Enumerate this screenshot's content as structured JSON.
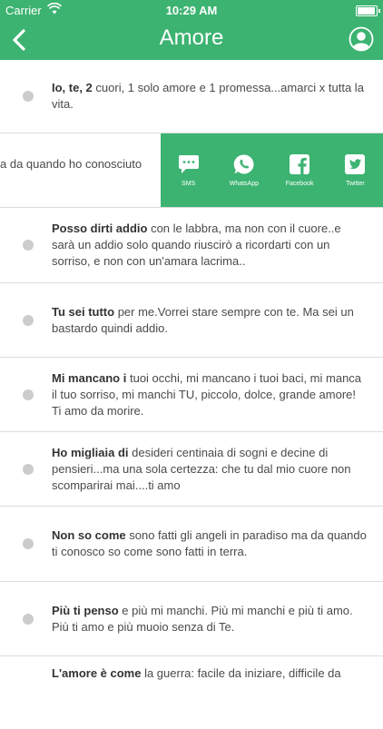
{
  "status_bar": {
    "carrier": "Carrier",
    "time": "10:29 AM"
  },
  "header": {
    "title": "Amore"
  },
  "swipe_row": {
    "partial_text": "a da  quando ho conosciuto",
    "actions": [
      {
        "label": "SMS",
        "icon": "sms-icon"
      },
      {
        "label": "WhatsApp",
        "icon": "whatsapp-icon"
      },
      {
        "label": "Facebook",
        "icon": "facebook-icon"
      },
      {
        "label": "Twitter",
        "icon": "twitter-icon"
      }
    ]
  },
  "quotes": [
    {
      "lead": "Io, te, 2",
      "rest": " cuori, 1 solo amore e 1 promessa...amarci x tutta la vita."
    },
    {
      "lead": "Posso dirti addio",
      "rest": " con le labbra, ma non con il cuore..e sarà un addio solo quando riuscirò a ricordarti con un sorriso, e non con un'amara lacrima.."
    },
    {
      "lead": "Tu sei tutto",
      "rest": " per me.Vorrei stare sempre con te. Ma sei un bastardo quindi addio."
    },
    {
      "lead": "Mi mancano i",
      "rest": " tuoi occhi, mi mancano i tuoi baci, mi manca il tuo sorriso, mi manchi TU, piccolo, dolce, grande amore! Ti amo da morire."
    },
    {
      "lead": "Ho migliaia di",
      "rest": " desideri centinaia di sogni e decine di pensieri...ma una sola certezza: che tu dal mio cuore non scomparirai mai....ti amo"
    },
    {
      "lead": "Non so come",
      "rest": " sono fatti gli angeli in paradiso ma da quando ti conosco so come sono fatti in terra."
    },
    {
      "lead": "Più ti penso",
      "rest": " e più mi manchi. Più mi manchi e più ti amo. Più ti amo e più muoio senza di Te."
    },
    {
      "lead": "L'amore è come",
      "rest": " la guerra: facile da iniziare, difficile da"
    }
  ]
}
